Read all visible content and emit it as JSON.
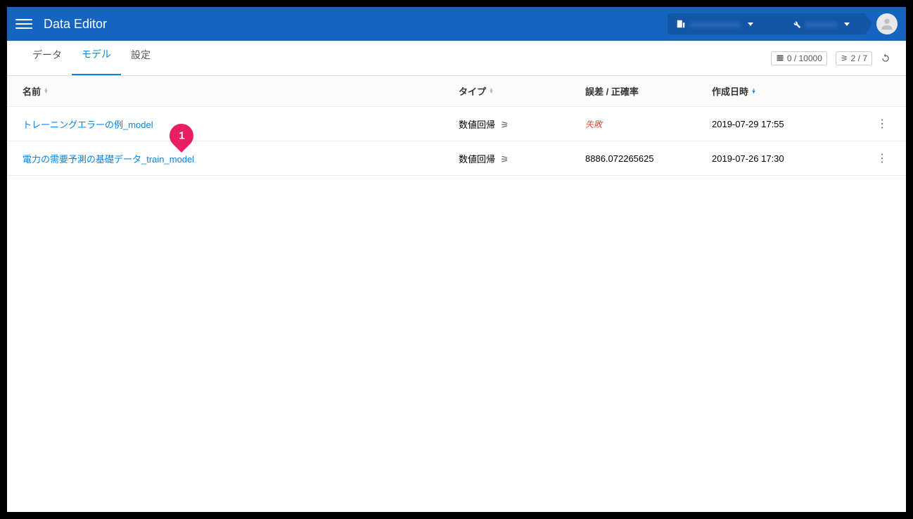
{
  "header": {
    "title": "Data Editor",
    "breadcrumb": [
      "obscured",
      "obscured"
    ]
  },
  "tabs": {
    "data": "データ",
    "model": "モデル",
    "settings": "設定",
    "activeIndex": 1
  },
  "status": {
    "data_count": "0 / 10000",
    "model_count": "2 / 7"
  },
  "table": {
    "headers": {
      "name": "名前",
      "type": "タイプ",
      "loss": "誤差 / 正確率",
      "date": "作成日時"
    },
    "rows": [
      {
        "name": "トレーニングエラーの例_model",
        "type": "数値回帰",
        "loss": "失敗",
        "loss_failed": true,
        "date": "2019-07-29 17:55"
      },
      {
        "name": "電力の需要予測の基礎データ_train_model",
        "type": "数値回帰",
        "loss": "8886.072265625",
        "loss_failed": false,
        "date": "2019-07-26 17:30"
      }
    ]
  },
  "annotation": {
    "label": "1"
  }
}
